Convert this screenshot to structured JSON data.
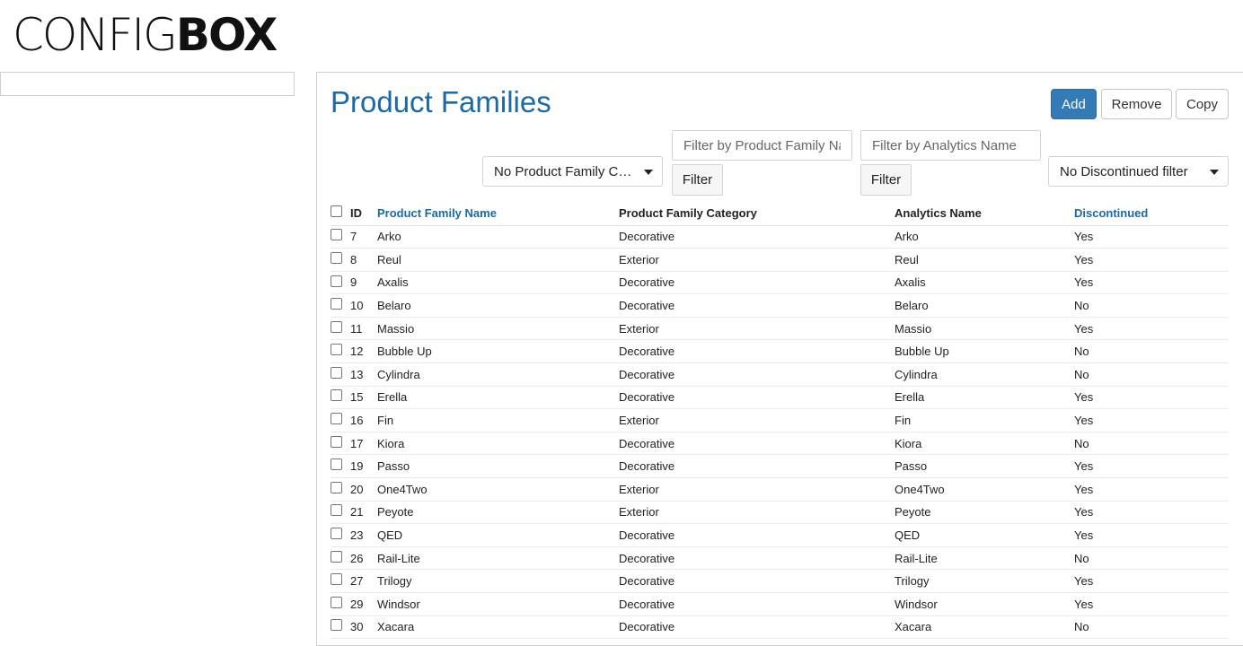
{
  "logo": {
    "light": "CONFIG",
    "bold": "BOX"
  },
  "page": {
    "title": "Product Families"
  },
  "actions": {
    "add": "Add",
    "remove": "Remove",
    "copy": "Copy"
  },
  "filters": {
    "category_select": "No Product Family Cat…",
    "name_placeholder": "Filter by Product Family Name",
    "name_filter_button": "Filter",
    "analytics_placeholder": "Filter by Analytics Name",
    "analytics_filter_button": "Filter",
    "discontinued_select": "No Discontinued filter"
  },
  "table": {
    "headers": {
      "id": "ID",
      "name": "Product Family Name",
      "category": "Product Family Category",
      "analytics": "Analytics Name",
      "discontinued": "Discontinued"
    },
    "rows": [
      {
        "id": "7",
        "name": "Arko",
        "category": "Decorative",
        "analytics": "Arko",
        "discontinued": "Yes"
      },
      {
        "id": "8",
        "name": "Reul",
        "category": "Exterior",
        "analytics": "Reul",
        "discontinued": "Yes"
      },
      {
        "id": "9",
        "name": "Axalis",
        "category": "Decorative",
        "analytics": "Axalis",
        "discontinued": "Yes"
      },
      {
        "id": "10",
        "name": "Belaro",
        "category": "Decorative",
        "analytics": "Belaro",
        "discontinued": "No"
      },
      {
        "id": "11",
        "name": "Massio",
        "category": "Exterior",
        "analytics": "Massio",
        "discontinued": "Yes"
      },
      {
        "id": "12",
        "name": "Bubble Up",
        "category": "Decorative",
        "analytics": "Bubble Up",
        "discontinued": "No"
      },
      {
        "id": "13",
        "name": "Cylindra",
        "category": "Decorative",
        "analytics": "Cylindra",
        "discontinued": "No"
      },
      {
        "id": "15",
        "name": "Erella",
        "category": "Decorative",
        "analytics": "Erella",
        "discontinued": "Yes"
      },
      {
        "id": "16",
        "name": "Fin",
        "category": "Exterior",
        "analytics": "Fin",
        "discontinued": "Yes"
      },
      {
        "id": "17",
        "name": "Kiora",
        "category": "Decorative",
        "analytics": "Kiora",
        "discontinued": "No"
      },
      {
        "id": "19",
        "name": "Passo",
        "category": "Decorative",
        "analytics": "Passo",
        "discontinued": "Yes"
      },
      {
        "id": "20",
        "name": "One4Two",
        "category": "Exterior",
        "analytics": "One4Two",
        "discontinued": "Yes"
      },
      {
        "id": "21",
        "name": "Peyote",
        "category": "Exterior",
        "analytics": "Peyote",
        "discontinued": "Yes"
      },
      {
        "id": "23",
        "name": "QED",
        "category": "Decorative",
        "analytics": "QED",
        "discontinued": "Yes"
      },
      {
        "id": "26",
        "name": "Rail-Lite",
        "category": "Decorative",
        "analytics": "Rail-Lite",
        "discontinued": "No"
      },
      {
        "id": "27",
        "name": "Trilogy",
        "category": "Decorative",
        "analytics": "Trilogy",
        "discontinued": "Yes"
      },
      {
        "id": "29",
        "name": "Windsor",
        "category": "Decorative",
        "analytics": "Windsor",
        "discontinued": "Yes"
      },
      {
        "id": "30",
        "name": "Xacara",
        "category": "Decorative",
        "analytics": "Xacara",
        "discontinued": "No"
      }
    ]
  }
}
